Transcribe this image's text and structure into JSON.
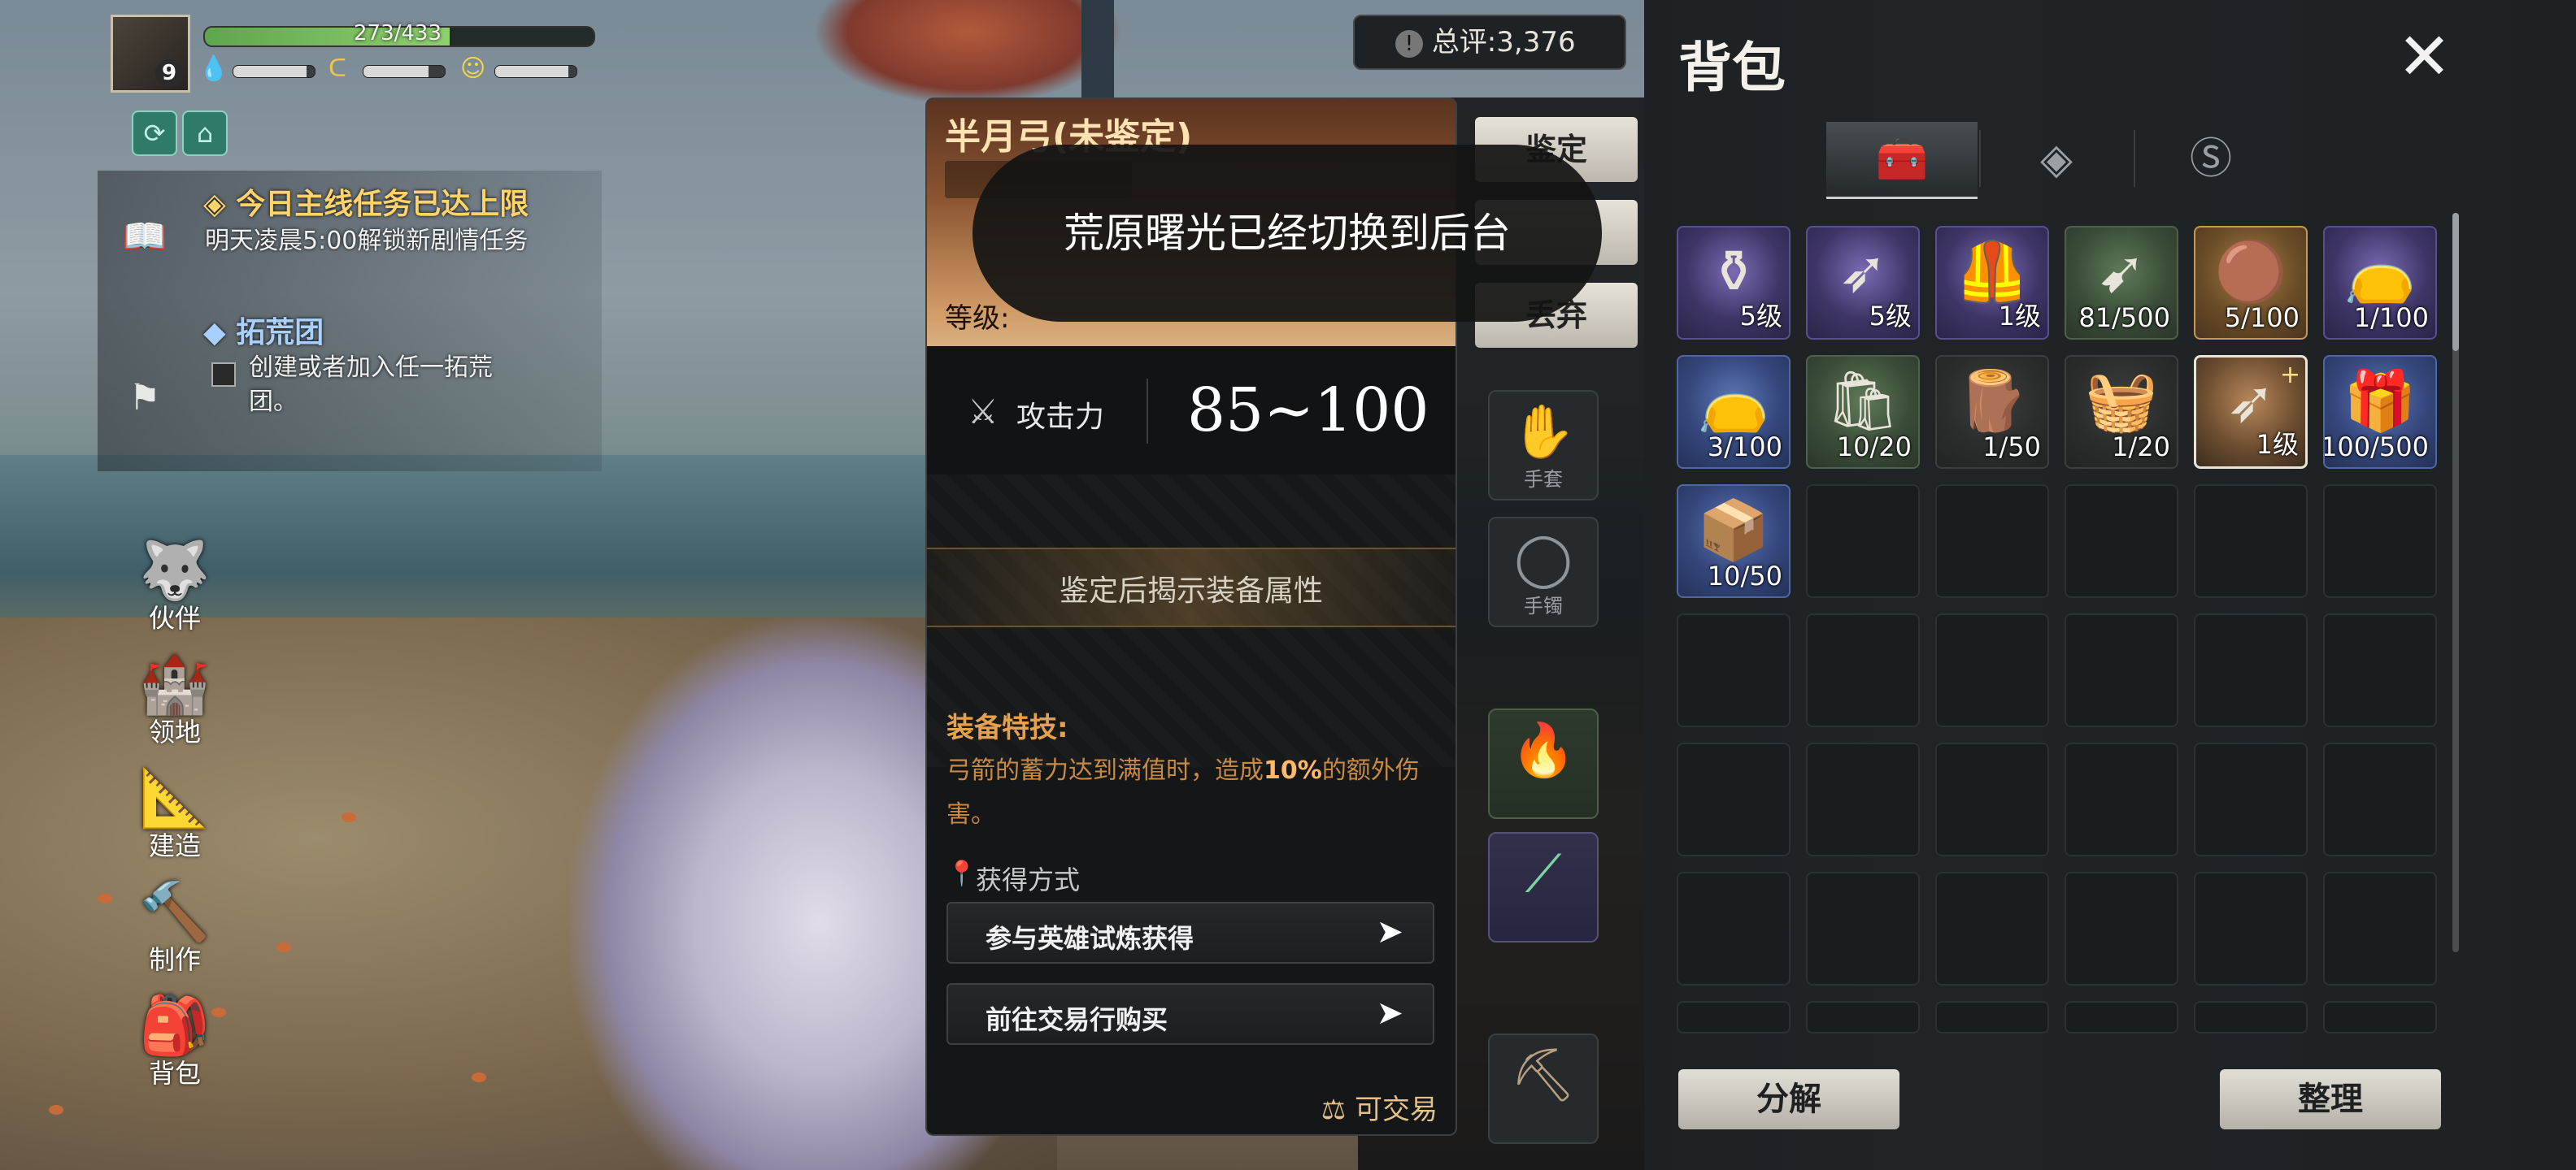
{
  "hud": {
    "hp_text": "273/433",
    "hp_fraction": 0.63,
    "level": "9",
    "water_fraction": 0.9,
    "food_fraction": 0.8,
    "mood_fraction": 0.9
  },
  "quests": [
    {
      "title": "今日主线任务已达上限",
      "desc": "明天凌晨5:00解锁新剧情任务"
    },
    {
      "title": "拓荒团",
      "desc_lines": [
        "创建或者加入任一拓荒",
        "团。"
      ]
    }
  ],
  "side_menu": [
    {
      "label": "伙伴",
      "icon": "wolf-icon"
    },
    {
      "label": "领地",
      "icon": "castle-icon"
    },
    {
      "label": "建造",
      "icon": "build-icon"
    },
    {
      "label": "制作",
      "icon": "hammer-icon"
    },
    {
      "label": "背包",
      "icon": "backpack-icon"
    }
  ],
  "score": {
    "label": "总评:3,376"
  },
  "equipment": {
    "buttons": [
      "鉴定",
      "",
      "丢弃"
    ],
    "slots": [
      {
        "label": "",
        "icon": "armor-slot-icon"
      },
      {
        "label": "手套",
        "icon": "glove-icon"
      },
      {
        "label": "手镯",
        "icon": "bracelet-icon"
      }
    ]
  },
  "tooltip": {
    "name": "半月弓(未鉴定)",
    "grade_label": "等级:",
    "attack_label": "攻击力",
    "attack_value": "85~100",
    "locked_text": "鉴定后揭示装备属性",
    "skill_title": "装备特技:",
    "skill_desc_prefix": "弓箭的蓄力达到满值时，造成",
    "skill_desc_highlight": "10%",
    "skill_desc_suffix": "的额外伤害。",
    "obtain_title": "获得方式",
    "obtain_options": [
      "参与英雄试炼获得",
      "前往交易行购买"
    ],
    "tradable": "可交易"
  },
  "toast": {
    "text": "荒原曙光已经切换到后台"
  },
  "bag": {
    "title": "背包",
    "tabs": [
      {
        "icon": "chest-icon",
        "active": true
      },
      {
        "icon": "gem-icon",
        "active": false
      },
      {
        "icon": "coin-icon",
        "active": false
      }
    ],
    "items": [
      {
        "qty": "5级",
        "rarity": "purple",
        "icon": "coffin-armor-icon"
      },
      {
        "qty": "5级",
        "rarity": "purple",
        "icon": "bow-icon"
      },
      {
        "qty": "1级",
        "rarity": "purple",
        "icon": "vest-icon"
      },
      {
        "qty": "81/500",
        "rarity": "green",
        "icon": "arrow-icon"
      },
      {
        "qty": "5/100",
        "rarity": "gold",
        "icon": "leather-icon"
      },
      {
        "qty": "1/100",
        "rarity": "purple",
        "icon": "potion-bag-icon"
      },
      {
        "qty": "3/100",
        "rarity": "blue",
        "icon": "potion-bag-icon"
      },
      {
        "qty": "10/20",
        "rarity": "green",
        "icon": "sack-icon"
      },
      {
        "qty": "1/50",
        "rarity": "dark",
        "icon": "wood-icon"
      },
      {
        "qty": "1/20",
        "rarity": "dark",
        "icon": "basket-icon"
      },
      {
        "qty": "1级",
        "rarity": "orange",
        "icon": "bow-icon",
        "badge": "+"
      },
      {
        "qty": "100/500",
        "rarity": "blue",
        "icon": "treasure-chest-icon"
      },
      {
        "qty": "10/50",
        "rarity": "blue",
        "icon": "supply-box-icon"
      }
    ],
    "decompose_label": "分解",
    "sort_label": "整理"
  }
}
